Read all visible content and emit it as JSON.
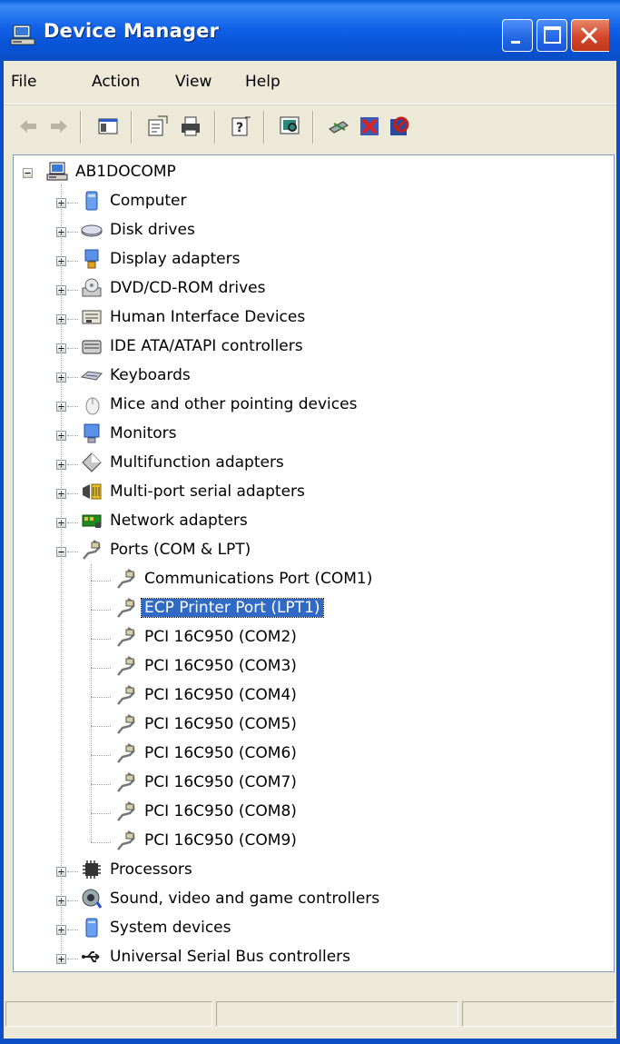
{
  "window": {
    "title": "Device Manager"
  },
  "menu": [
    "File",
    "Action",
    "View",
    "Help"
  ],
  "toolbar": {
    "icons": [
      "back-icon",
      "forward-icon",
      "show-hide-tree-icon",
      "properties-icon",
      "print-icon",
      "help-icon",
      "scan-hardware-icon",
      "update-driver-icon",
      "uninstall-icon",
      "disable-icon"
    ]
  },
  "tree": {
    "root": "AB1DOCOMP",
    "categories": [
      {
        "label": "Computer",
        "icon": "computer-icon"
      },
      {
        "label": "Disk drives",
        "icon": "disk-drive-icon"
      },
      {
        "label": "Display adapters",
        "icon": "display-adapter-icon"
      },
      {
        "label": "DVD/CD-ROM drives",
        "icon": "cdrom-icon"
      },
      {
        "label": "Human Interface Devices",
        "icon": "hid-icon"
      },
      {
        "label": "IDE ATA/ATAPI controllers",
        "icon": "ide-controller-icon"
      },
      {
        "label": "Keyboards",
        "icon": "keyboard-icon"
      },
      {
        "label": "Mice and other pointing devices",
        "icon": "mouse-icon"
      },
      {
        "label": "Monitors",
        "icon": "monitor-icon"
      },
      {
        "label": "Multifunction adapters",
        "icon": "multifunction-icon"
      },
      {
        "label": "Multi-port serial adapters",
        "icon": "multiport-serial-icon"
      },
      {
        "label": "Network adapters",
        "icon": "network-adapter-icon"
      },
      {
        "label": "Ports (COM & LPT)",
        "icon": "port-icon",
        "expanded": true
      },
      {
        "label": "Processors",
        "icon": "processor-icon"
      },
      {
        "label": "Sound, video and game controllers",
        "icon": "sound-icon"
      },
      {
        "label": "System devices",
        "icon": "system-device-icon"
      },
      {
        "label": "Universal Serial Bus controllers",
        "icon": "usb-icon"
      }
    ],
    "ports": [
      "Communications Port (COM1)",
      "ECP Printer Port (LPT1)",
      "PCI 16C950 (COM2)",
      "PCI 16C950 (COM3)",
      "PCI 16C950 (COM4)",
      "PCI 16C950 (COM5)",
      "PCI 16C950 (COM6)",
      "PCI 16C950 (COM7)",
      "PCI 16C950 (COM8)",
      "PCI 16C950 (COM9)"
    ],
    "selected_port": "ECP Printer Port (LPT1)"
  },
  "colors": {
    "titlebar": "#0a5fdc",
    "selection": "#316ac5",
    "chrome": "#ece9d8"
  }
}
